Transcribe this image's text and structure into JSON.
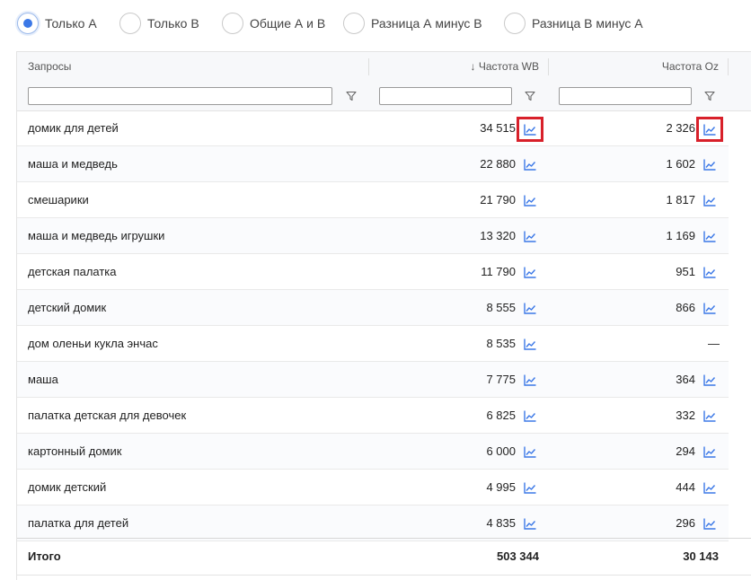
{
  "filters": {
    "options": [
      {
        "label": "Только А",
        "checked": true
      },
      {
        "label": "Только В",
        "checked": false
      },
      {
        "label": "Общие А и В",
        "checked": false
      },
      {
        "label": "Разница А минус В",
        "checked": false
      },
      {
        "label": "Разница В минус А",
        "checked": false
      }
    ]
  },
  "table": {
    "headers": {
      "query": "Запросы",
      "wb": "↓ Частота WB",
      "oz": "Частота Oz"
    },
    "filter_inputs": {
      "query": "",
      "wb": "",
      "oz": ""
    },
    "rows": [
      {
        "query": "домик для детей",
        "wb": "34 515",
        "oz": "2 326"
      },
      {
        "query": "маша и медведь",
        "wb": "22 880",
        "oz": "1 602"
      },
      {
        "query": "смешарики",
        "wb": "21 790",
        "oz": "1 817"
      },
      {
        "query": "маша и медведь игрушки",
        "wb": "13 320",
        "oz": "1 169"
      },
      {
        "query": "детская палатка",
        "wb": "11 790",
        "oz": "951"
      },
      {
        "query": "детский домик",
        "wb": "8 555",
        "oz": "866"
      },
      {
        "query": "дом оленьи кукла энчас",
        "wb": "8 535",
        "oz": "—"
      },
      {
        "query": "маша",
        "wb": "7 775",
        "oz": "364"
      },
      {
        "query": "палатка детская для девочек",
        "wb": "6 825",
        "oz": "332"
      },
      {
        "query": "картонный домик",
        "wb": "6 000",
        "oz": "294"
      },
      {
        "query": "домик детский",
        "wb": "4 995",
        "oz": "444"
      },
      {
        "query": "палатка для детей",
        "wb": "4 835",
        "oz": "296"
      }
    ],
    "total": {
      "label": "Итого",
      "wb": "503 344",
      "oz": "30 143"
    }
  },
  "colors": {
    "accent": "#3b78e7",
    "chart_icon": "#3b78e7",
    "highlight_box": "#d8202a"
  },
  "icons": {
    "filter": "funnel-icon",
    "row_chart": "line-chart-icon"
  }
}
